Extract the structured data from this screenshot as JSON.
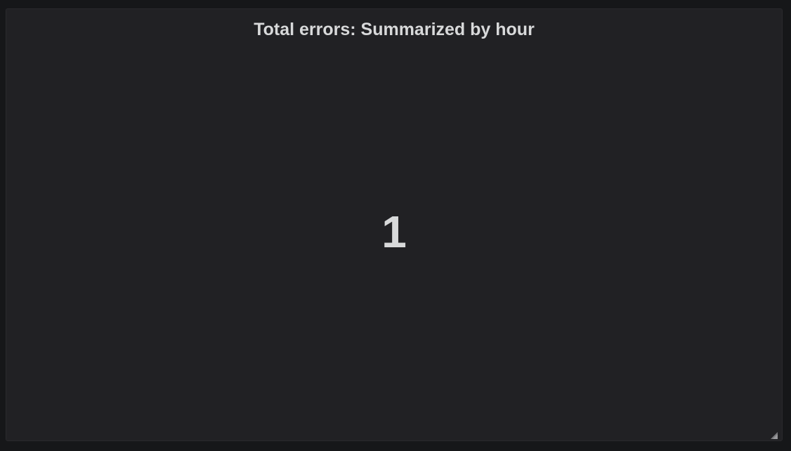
{
  "panel": {
    "title": "Total errors: Summarized by hour",
    "value": "1",
    "icons": {
      "resize": "resize-handle-icon"
    }
  },
  "colors": {
    "page_background": "#161719",
    "panel_background": "#212124",
    "text": "#d8d9da",
    "handle": "#7b7b7e"
  }
}
